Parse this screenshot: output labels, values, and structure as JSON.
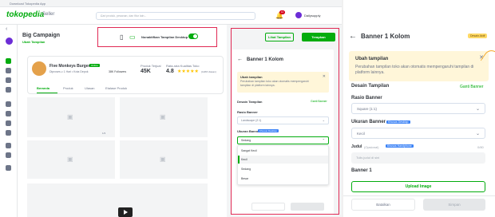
{
  "download_bar": "Download Tokopedia App",
  "header": {
    "logo": "tokopedia",
    "seller": "Seller",
    "search_placeholder": "Cari produk, pesanan, dan fitur lain...",
    "notif_count": "12",
    "username": "Dailysupply"
  },
  "page": {
    "title": "Big Campaign",
    "subtitle": "Ubah Tampilan",
    "toggle_label": "Nonaktifkan Tampilan Desktop"
  },
  "shop": {
    "name": "Five Monkeys Burger",
    "badge": "Online",
    "meta": "Diproses ≥ 1 Hari   •   Kota Depok",
    "followers": "38K Followers",
    "sold_label": "Produk Terjual",
    "sold_value": "45K",
    "rating_label": "Rata-rata Kualitas Toko",
    "rating_value": "4.8",
    "stars": "★★★★★",
    "reviews": "(1280 Ulasan)"
  },
  "tabs": [
    "Beranda",
    "Produk",
    "Ulasan",
    "Etalase Produk"
  ],
  "photo_count": "1/3",
  "actions": {
    "preview": "Lihat Tampilan",
    "apply": "Terapkan"
  },
  "mini": {
    "title": "Banner 1 Kolom",
    "note_title": "Ubah tampilan",
    "note_text": "Perubahan tampilan toko akan otomatis mempengaruhi tampilan di platform lainnya.",
    "desain": "Desain Tampilan",
    "ganti": "Ganti Banner",
    "rasio": "Rasio Banner",
    "rasio_value": "Landscape (2:1)",
    "ukuran": "Ukuran Banner",
    "ukuran_badge": "Khusus Desktop",
    "ukuran_value": "Sedang",
    "options": [
      "Sangat Kecil",
      "Kecil",
      "Sedang",
      "Besar"
    ]
  },
  "right": {
    "title": "Banner 1 Kolom",
    "badge": "Desain Aktif",
    "note_title": "Ubah tampilan",
    "note_text": "Perubahan tampilan toko akan otomatis mempengaruhi tampilan di platform lainnya.",
    "desain": "Desain Tampilan",
    "ganti": "Ganti Banner",
    "rasio": "Rasio Banner",
    "rasio_value": "Square (1:1)",
    "ukuran": "Ukuran Banner",
    "ukuran_badge": "Khusus Desktop",
    "ukuran_value": "Kecil",
    "judul": "Judul",
    "opsional": "(Opsional)",
    "judul_badge": "Khusus Handphone",
    "count": "0/80",
    "input_placeholder": "Tulis judul di sini",
    "banner1": "Banner 1",
    "upload": "Upload Image",
    "cancel": "Batalkan",
    "save": "Simpan"
  },
  "colors": {
    "brand": "#03ac0e",
    "alert": "#e02954",
    "note": "#fff6d9"
  }
}
